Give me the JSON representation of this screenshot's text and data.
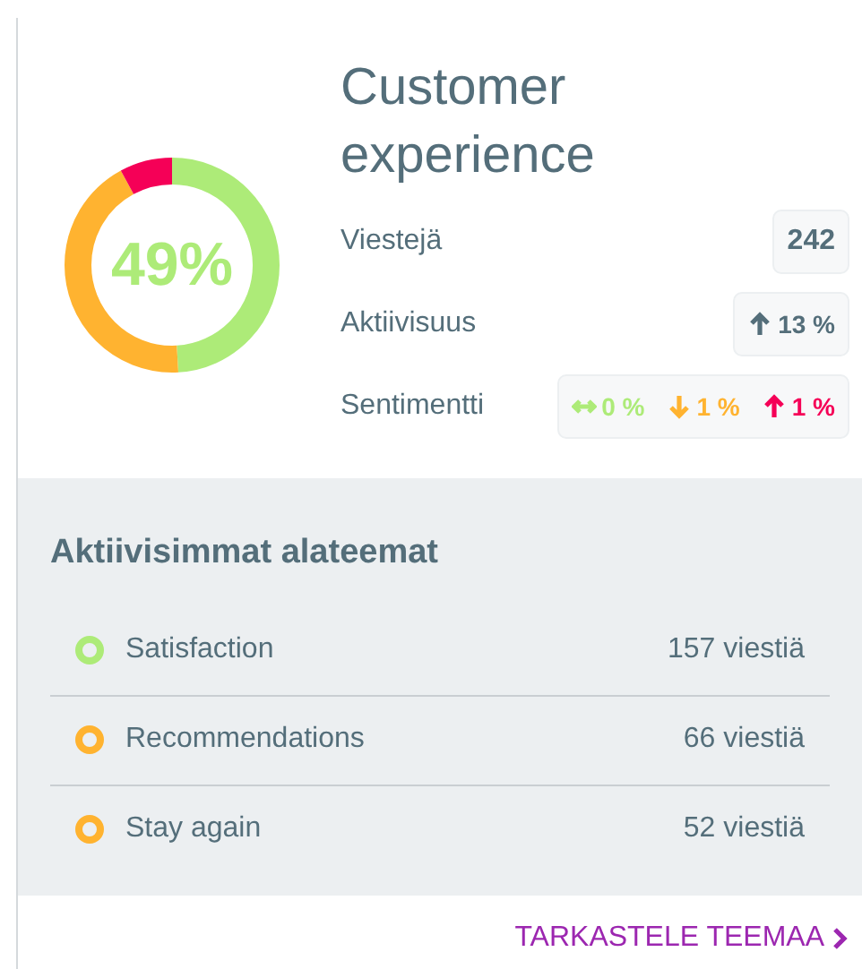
{
  "donut": {
    "label": "49%",
    "segments": [
      {
        "color": "#adeb78",
        "level": 0.49
      },
      {
        "color": "#ffb330",
        "level": 0.43
      },
      {
        "color": "#f50057",
        "level": 0.08
      }
    ]
  },
  "title": "Customer experience",
  "stats": [
    {
      "label": "Viestejä",
      "kind": "count",
      "value": "242"
    },
    {
      "label": "Aktiivisuus",
      "kind": "trend",
      "items": [
        {
          "kind": "up",
          "color": "#546e7a",
          "value": "13 %"
        }
      ]
    },
    {
      "label": "Sentimentti",
      "kind": "trend",
      "items": [
        {
          "kind": "flat",
          "color": "#adeb78",
          "value": "0 %"
        },
        {
          "kind": "down",
          "color": "#ffb330",
          "value": "1 %"
        },
        {
          "kind": "up",
          "color": "#f50057",
          "value": "1 %"
        }
      ]
    }
  ],
  "subtopics": {
    "heading": "Aktiivisimmat alateemat",
    "items": [
      {
        "name": "Satisfaction",
        "color": "#adeb78",
        "count": "157 viestiä"
      },
      {
        "name": "Recommendations",
        "color": "#ffb330",
        "count": "66 viestiä"
      },
      {
        "name": "Stay again",
        "color": "#ffb330",
        "count": "52 viestiä"
      }
    ]
  },
  "link": "TARKASTELE TEEMAA"
}
